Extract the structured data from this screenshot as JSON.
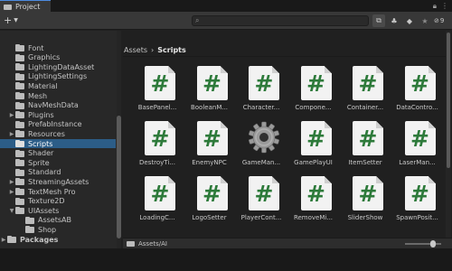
{
  "window": {
    "tab_label": "Project",
    "more_icon": "kebab-menu-icon",
    "lock_icon": "lock-icon"
  },
  "toolbar": {
    "create_label": "+",
    "search": {
      "placeholder": "",
      "value": ""
    },
    "hidden_count": "9"
  },
  "tree": {
    "items": [
      {
        "label": "Font",
        "expandable": false
      },
      {
        "label": "Graphics",
        "expandable": false
      },
      {
        "label": "LightingDataAsset",
        "expandable": false
      },
      {
        "label": "LightingSettings",
        "expandable": false
      },
      {
        "label": "Material",
        "expandable": false
      },
      {
        "label": "Mesh",
        "expandable": false
      },
      {
        "label": "NavMeshData",
        "expandable": false
      },
      {
        "label": "Plugins",
        "expandable": true
      },
      {
        "label": "PrefabInstance",
        "expandable": false
      },
      {
        "label": "Resources",
        "expandable": true
      },
      {
        "label": "Scripts",
        "expandable": false,
        "selected": true
      },
      {
        "label": "Shader",
        "expandable": false
      },
      {
        "label": "Sprite",
        "expandable": false
      },
      {
        "label": "Standard",
        "expandable": false
      },
      {
        "label": "StreamingAssets",
        "expandable": true
      },
      {
        "label": "TextMesh Pro",
        "expandable": true
      },
      {
        "label": "Texture2D",
        "expandable": false
      },
      {
        "label": "UIAssets",
        "expandable": true,
        "expanded": true
      },
      {
        "label": "AssetsAB",
        "expandable": false,
        "indent": 1
      },
      {
        "label": "Shop",
        "expandable": false,
        "indent": 1
      },
      {
        "label": "Packages",
        "expandable": true,
        "root": true
      }
    ]
  },
  "breadcrumb": {
    "root": "Assets",
    "separator": "›",
    "current": "Scripts"
  },
  "assets": [
    {
      "name": "BasePanel...",
      "icon": "csharp-script-icon"
    },
    {
      "name": "BooleanM...",
      "icon": "csharp-script-icon"
    },
    {
      "name": "Character...",
      "icon": "csharp-script-icon"
    },
    {
      "name": "Compone...",
      "icon": "csharp-script-icon"
    },
    {
      "name": "Container...",
      "icon": "csharp-script-icon"
    },
    {
      "name": "DataContro...",
      "icon": "csharp-script-icon"
    },
    {
      "name": "DestroyTi...",
      "icon": "csharp-script-icon"
    },
    {
      "name": "EnemyNPC",
      "icon": "csharp-script-icon"
    },
    {
      "name": "GameMan...",
      "icon": "gear-icon"
    },
    {
      "name": "GamePlayUI",
      "icon": "csharp-script-icon"
    },
    {
      "name": "ItemSetter",
      "icon": "csharp-script-icon"
    },
    {
      "name": "LaserMan...",
      "icon": "csharp-script-icon"
    },
    {
      "name": "LoadingC...",
      "icon": "csharp-script-icon"
    },
    {
      "name": "LogoSetter",
      "icon": "csharp-script-icon"
    },
    {
      "name": "PlayerCont...",
      "icon": "csharp-script-icon"
    },
    {
      "name": "RemoveMi...",
      "icon": "csharp-script-icon"
    },
    {
      "name": "SliderShow",
      "icon": "csharp-script-icon"
    },
    {
      "name": "SpawnPosit...",
      "icon": "csharp-script-icon"
    }
  ],
  "status": {
    "path": "Assets/AI"
  },
  "colors": {
    "selection": "#2c5d87",
    "script_hash": "#2d7a3a",
    "panel": "#282828"
  }
}
